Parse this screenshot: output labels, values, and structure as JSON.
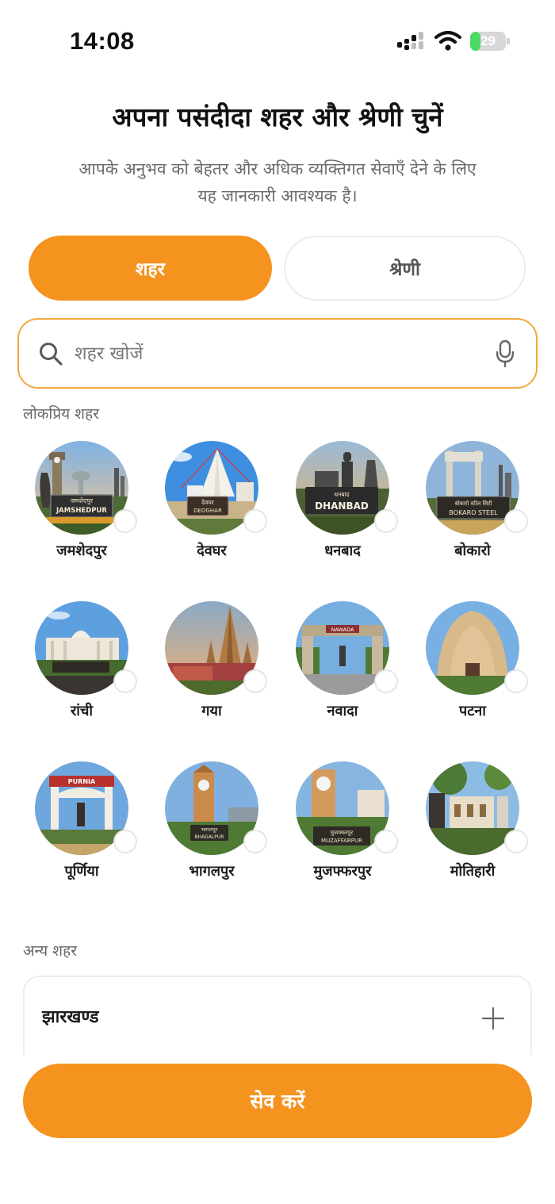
{
  "status_bar": {
    "time": "14:08",
    "battery": "29",
    "battery_level": 0.29
  },
  "header": {
    "title": "अपना पसंदीदा शहर और श्रेणी चुनें",
    "subtitle_line1": "आपके अनुभव को बेहतर और अधिक व्यक्तिगत सेवाएँ देने के लिए",
    "subtitle_line2": "यह जानकारी आवश्यक है।"
  },
  "tabs": {
    "city": "शहर",
    "category": "श्रेणी",
    "active": "city"
  },
  "search": {
    "placeholder": "शहर खोजें",
    "value": ""
  },
  "popular": {
    "label": "लोकप्रिय शहर",
    "cities": [
      {
        "name": "जमशेदपुर",
        "sign_top": "जमशेदपुर",
        "sign_bottom": "JAMSHEDPUR",
        "selected": false
      },
      {
        "name": "देवघर",
        "sign_top": "देवघर",
        "sign_bottom": "DEOGHAR",
        "selected": false
      },
      {
        "name": "धनबाद",
        "sign_top": "धनबाद",
        "sign_bottom": "DHANBAD",
        "selected": false
      },
      {
        "name": "बोकारो",
        "sign_top": "बोकारो स्टील सिटी",
        "sign_bottom": "BOKARO STEEL",
        "selected": false
      },
      {
        "name": "रांची",
        "selected": false
      },
      {
        "name": "गया",
        "selected": false
      },
      {
        "name": "नवादा",
        "sign_top": "NAWADA",
        "selected": false
      },
      {
        "name": "पटना",
        "selected": false
      },
      {
        "name": "पूर्णिया",
        "sign_top": "PURNIA",
        "selected": false
      },
      {
        "name": "भागलपुर",
        "sign_top": "भागलपुर",
        "sign_bottom": "BHAGALPUR",
        "selected": false
      },
      {
        "name": "मुजफ्फरपुर",
        "sign_top": "मुजफ्फरपुर",
        "sign_bottom": "MUZAFFARPUR",
        "selected": false
      },
      {
        "name": "मोतिहारी",
        "selected": false
      }
    ]
  },
  "other": {
    "label": "अन्य शहर",
    "states": [
      {
        "name": "झारखण्ड",
        "expanded": false
      }
    ]
  },
  "save_button": "सेव करें",
  "colors": {
    "accent": "#f5931f",
    "accent_border": "#f5a73e",
    "battery_green": "#4cd964"
  }
}
